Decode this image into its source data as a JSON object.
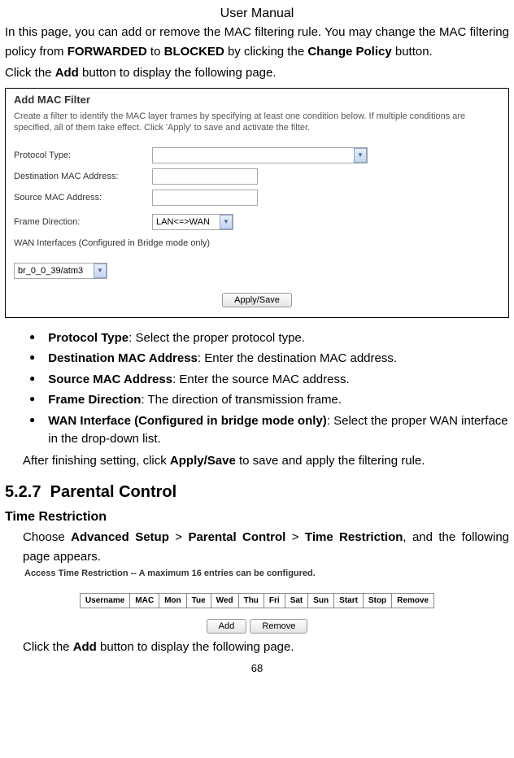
{
  "header": "User Manual",
  "intro": {
    "p1_pre": "In this page, you can add or remove the MAC filtering rule. You may change the MAC filtering policy from ",
    "p1_b1": "FORWARDED",
    "p1_mid": " to ",
    "p1_b2": "BLOCKED",
    "p1_mid2": " by clicking the ",
    "p1_b3": "Change Policy",
    "p1_post": " button.",
    "p2_pre": "Click the ",
    "p2_b": "Add",
    "p2_post": " button to display the following page."
  },
  "screenshot1": {
    "title": "Add MAC Filter",
    "desc": "Create a filter to identify the MAC layer frames by specifying at least one condition below. If multiple conditions are specified, all of them take effect. Click 'Apply' to save and activate the filter.",
    "labels": {
      "protocol": "Protocol Type:",
      "dest": "Destination MAC Address:",
      "source": "Source MAC Address:",
      "frame": "Frame Direction:",
      "wan": "WAN Interfaces (Configured in Bridge mode only)"
    },
    "frame_value": "LAN<=>WAN",
    "wan_value": "br_0_0_39/atm3",
    "apply_btn": "Apply/Save"
  },
  "bullets": {
    "b1_bold": "Protocol Type",
    "b1_rest": ": Select the proper protocol type.",
    "b2_bold": "Destination MAC Address",
    "b2_rest": ": Enter the destination MAC address.",
    "b3_bold": "Source MAC Address",
    "b3_rest": ": Enter the source MAC address.",
    "b4_bold": "Frame Direction",
    "b4_rest": ": The direction of transmission frame.",
    "b5_bold": "WAN Interface (Configured in bridge mode only)",
    "b5_rest": ": Select the proper WAN interface in the drop-down list."
  },
  "after": {
    "pre": "After finishing setting, click ",
    "bold": "Apply/Save",
    "post": " to save and apply the filtering rule."
  },
  "section": {
    "num": "5.2.7",
    "title": "Parental Control"
  },
  "subsection": "Time Restriction",
  "choose": {
    "pre": "Choose ",
    "b1": "Advanced Setup",
    "s1": " > ",
    "b2": "Parental Control",
    "s2": " > ",
    "b3": "Time Restriction",
    "post": ", and the following page appears."
  },
  "screenshot2": {
    "title": "Access Time Restriction -- A maximum 16 entries can be configured.",
    "headers": [
      "Username",
      "MAC",
      "Mon",
      "Tue",
      "Wed",
      "Thu",
      "Fri",
      "Sat",
      "Sun",
      "Start",
      "Stop",
      "Remove"
    ],
    "add_btn": "Add",
    "remove_btn": "Remove"
  },
  "click2": {
    "pre": "Click the ",
    "bold": "Add",
    "post": " button to display the following page."
  },
  "page_num": "68"
}
